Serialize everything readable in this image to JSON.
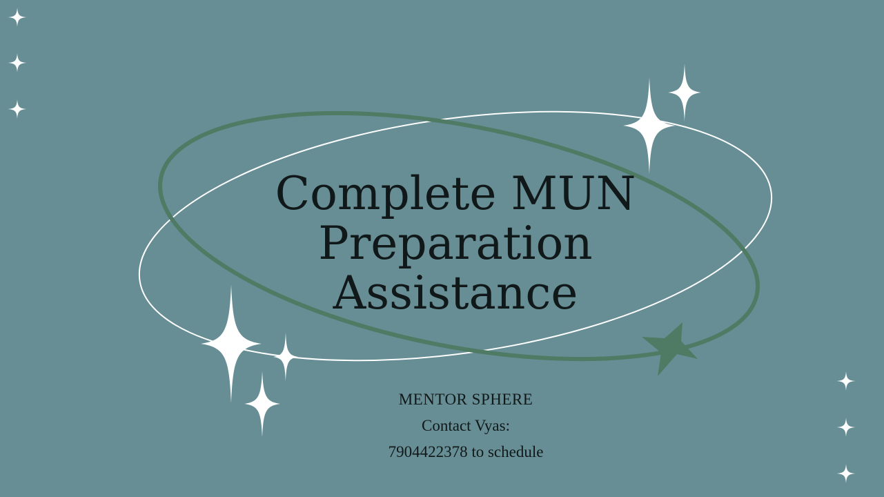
{
  "title": {
    "lines": [
      "Complete MUN",
      "Preparation",
      "Assistance"
    ]
  },
  "info": {
    "brand": "MENTOR SPHERE",
    "contact": "Contact Vyas:",
    "schedule": "7904422378 to schedule"
  },
  "colors": {
    "background": "#668e94",
    "accent_green": "#4f7a63",
    "sparkle": "#ffffff",
    "text": "#111819"
  },
  "icons": [
    "sparkle-icon",
    "star-icon"
  ]
}
